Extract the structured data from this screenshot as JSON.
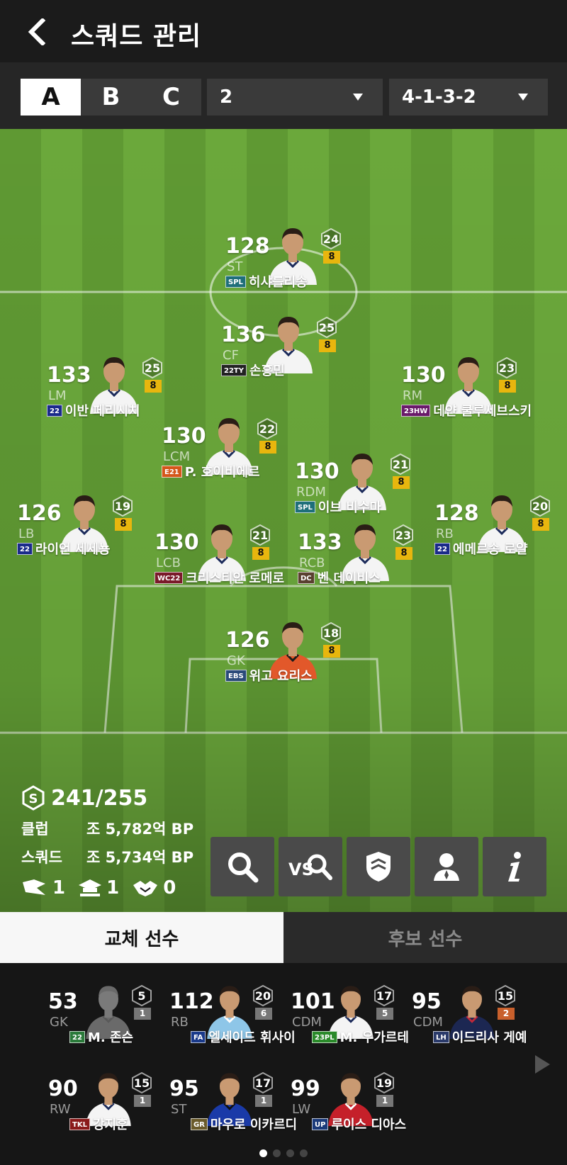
{
  "header": {
    "title": "스쿼드 관리"
  },
  "toolbar": {
    "squad_tabs": [
      "A",
      "B",
      "C"
    ],
    "active_tab": "A",
    "squad_select": "2",
    "formation_select": "4-1-3-2"
  },
  "players": [
    {
      "ovr": "128",
      "pos": "ST",
      "level": "24",
      "grade": "8",
      "badge": "SPL",
      "badge_color": "#1f6f7a",
      "name": "히샤를리송",
      "kit": "white"
    },
    {
      "ovr": "136",
      "pos": "CF",
      "level": "25",
      "grade": "8",
      "badge": "22TY",
      "badge_color": "#222222",
      "name": "손흥민",
      "kit": "white"
    },
    {
      "ovr": "133",
      "pos": "LM",
      "level": "25",
      "grade": "8",
      "badge": "22",
      "badge_color": "#1a2a8a",
      "name": "이반 페리시치",
      "kit": "white"
    },
    {
      "ovr": "130",
      "pos": "RM",
      "level": "23",
      "grade": "8",
      "badge": "23HW",
      "badge_color": "#6a1a6a",
      "name": "데얀 쿨루세브스키",
      "kit": "white"
    },
    {
      "ovr": "130",
      "pos": "LCM",
      "level": "22",
      "grade": "8",
      "badge": "E21",
      "badge_color": "#d4561a",
      "name": "P. 호이비에르",
      "kit": "white"
    },
    {
      "ovr": "130",
      "pos": "RDM",
      "level": "21",
      "grade": "8",
      "badge": "SPL",
      "badge_color": "#1f6f7a",
      "name": "이브 비수마",
      "kit": "white"
    },
    {
      "ovr": "126",
      "pos": "LB",
      "level": "19",
      "grade": "8",
      "badge": "22",
      "badge_color": "#1a2a8a",
      "name": "라이언 세세뇽",
      "kit": "white"
    },
    {
      "ovr": "128",
      "pos": "RB",
      "level": "20",
      "grade": "8",
      "badge": "22",
      "badge_color": "#1a2a8a",
      "name": "에메르송 로얄",
      "kit": "white"
    },
    {
      "ovr": "130",
      "pos": "LCB",
      "level": "21",
      "grade": "8",
      "badge": "WC22",
      "badge_color": "#7a1a2a",
      "name": "크리스티안 로메로",
      "kit": "white"
    },
    {
      "ovr": "133",
      "pos": "RCB",
      "level": "23",
      "grade": "8",
      "badge": "DC",
      "badge_color": "#5a4030",
      "name": "벤 데이비스",
      "kit": "white"
    },
    {
      "ovr": "126",
      "pos": "GK",
      "level": "18",
      "grade": "8",
      "badge": "EBS",
      "badge_color": "#2a4a7a",
      "name": "위고 요리스",
      "kit": "orange"
    }
  ],
  "stats": {
    "salary": "241/255",
    "club_label": "클럽",
    "club_value": "조 5,782억 BP",
    "squad_label": "스쿼드",
    "squad_value": "조 5,734억 BP",
    "count_1": "1",
    "count_2": "1",
    "count_3": "0"
  },
  "actions": [
    "search-icon",
    "compare-icon",
    "team-icon",
    "coach-icon",
    "info-icon"
  ],
  "bottom_tabs": {
    "substitutes": "교체 선수",
    "reserves": "후보 선수"
  },
  "substitutes": [
    {
      "ovr": "53",
      "pos": "GK",
      "level": "5",
      "grade": "1",
      "badge": "22",
      "badge_color": "#2a7a3a",
      "name": "M. 존슨",
      "kit": "none"
    },
    {
      "ovr": "112",
      "pos": "RB",
      "level": "20",
      "grade": "6",
      "badge": "FA",
      "badge_color": "#1a3a8a",
      "name": "엘세이드 휘사이",
      "kit": "skyblue"
    },
    {
      "ovr": "101",
      "pos": "CDM",
      "level": "17",
      "grade": "5",
      "badge": "23PL",
      "badge_color": "#2a8a2a",
      "name": "M. 우가르테",
      "kit": "white"
    },
    {
      "ovr": "95",
      "pos": "CDM",
      "level": "15",
      "grade": "2",
      "badge": "LH",
      "badge_color": "#2a3a6a",
      "name": "이드리사 게예",
      "kit": "navy"
    },
    {
      "ovr": "90",
      "pos": "RW",
      "level": "15",
      "grade": "1",
      "badge": "TKL",
      "badge_color": "#8a1a1a",
      "name": "강지훈",
      "kit": "white"
    },
    {
      "ovr": "95",
      "pos": "ST",
      "level": "17",
      "grade": "1",
      "badge": "GR",
      "badge_color": "#6a5a2a",
      "name": "마우로 이카르디",
      "kit": "inter"
    },
    {
      "ovr": "99",
      "pos": "LW",
      "level": "19",
      "grade": "1",
      "badge": "UP",
      "badge_color": "#1a3a7a",
      "name": "루이스 디아스",
      "kit": "red"
    }
  ],
  "pagination": {
    "count": 4,
    "active": 0
  }
}
